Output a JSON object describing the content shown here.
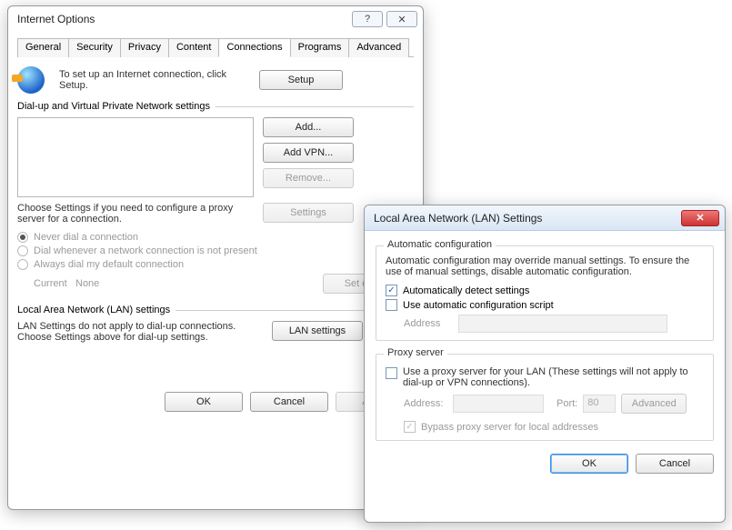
{
  "io": {
    "title": "Internet Options",
    "help_glyph": "?",
    "close_glyph": "✕",
    "tabs": [
      "General",
      "Security",
      "Privacy",
      "Content",
      "Connections",
      "Programs",
      "Advanced"
    ],
    "active_tab": "Connections",
    "setup_text": "To set up an Internet connection, click Setup.",
    "setup_btn": "Setup",
    "dialup_section": "Dial-up and Virtual Private Network settings",
    "add_btn": "Add...",
    "addvpn_btn": "Add VPN...",
    "remove_btn": "Remove...",
    "settings_btn": "Settings",
    "proxy_help": "Choose Settings if you need to configure a proxy server for a connection.",
    "radios": {
      "never": "Never dial a connection",
      "whenever": "Dial whenever a network connection is not present",
      "always": "Always dial my default connection"
    },
    "current_label": "Current",
    "current_value": "None",
    "setdefault_btn": "Set default",
    "lan_section": "Local Area Network (LAN) settings",
    "lan_help": "LAN Settings do not apply to dial-up connections. Choose Settings above for dial-up settings.",
    "lanbtn": "LAN settings",
    "ok": "OK",
    "cancel": "Cancel",
    "apply": "Apply"
  },
  "lan": {
    "title": "Local Area Network (LAN) Settings",
    "close_glyph": "✕",
    "auto_section": "Automatic configuration",
    "auto_help": "Automatic configuration may override manual settings.  To ensure the use of manual settings, disable automatic configuration.",
    "auto_detect": "Automatically detect settings",
    "auto_detect_checked": true,
    "auto_script": "Use automatic configuration script",
    "auto_script_checked": false,
    "address_label": "Address",
    "address_value": "",
    "proxy_section": "Proxy server",
    "proxy_use": "Use a proxy server for your LAN (These settings will not apply to dial-up or VPN connections).",
    "proxy_use_checked": false,
    "proxy_addr_label": "Address:",
    "proxy_addr_value": "",
    "proxy_port_label": "Port:",
    "proxy_port_value": "80",
    "advanced_btn": "Advanced",
    "bypass": "Bypass proxy server for local addresses",
    "bypass_checked": true,
    "ok": "OK",
    "cancel": "Cancel"
  }
}
